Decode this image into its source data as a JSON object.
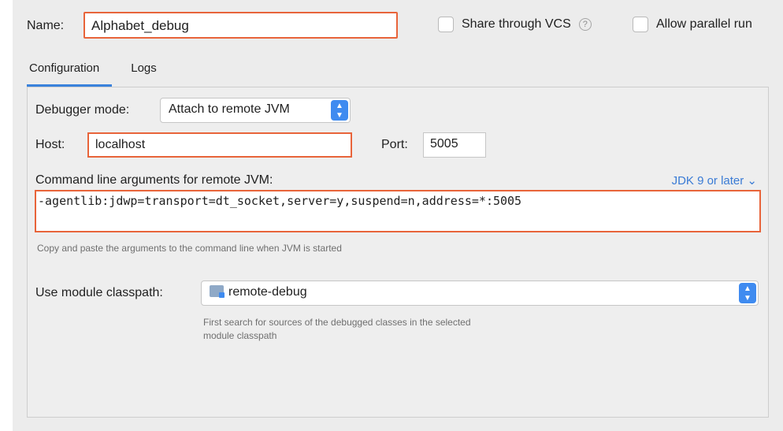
{
  "header": {
    "name_label": "Name:",
    "name_value": "Alphabet_debug",
    "share_vcs_label": "Share through VCS",
    "help_glyph": "?",
    "allow_parallel_label": "Allow parallel run"
  },
  "tabs": [
    {
      "label": "Configuration",
      "active": true
    },
    {
      "label": "Logs",
      "active": false
    }
  ],
  "config": {
    "debugger_mode_label": "Debugger mode:",
    "debugger_mode_value": "Attach to remote JVM",
    "host_label": "Host:",
    "host_value": "localhost",
    "port_label": "Port:",
    "port_value": "5005",
    "args_label": "Command line arguments for remote JVM:",
    "jdk_link": "JDK 9 or later ⌄",
    "args_value": "-agentlib:jdwp=transport=dt_socket,server=y,suspend=n,address=*:5005",
    "args_hint": "Copy and paste the arguments to the command line when JVM is started",
    "classpath_label": "Use module classpath:",
    "classpath_value": "remote-debug",
    "classpath_hint_line1": "First search for sources of the debugged classes in the selected",
    "classpath_hint_line2": "module classpath"
  },
  "colors": {
    "highlight": "#e8643a",
    "accent": "#3a82db",
    "link": "#3a7bd5"
  },
  "icons": [
    "help-icon",
    "select-arrow-icon",
    "module-icon"
  ]
}
